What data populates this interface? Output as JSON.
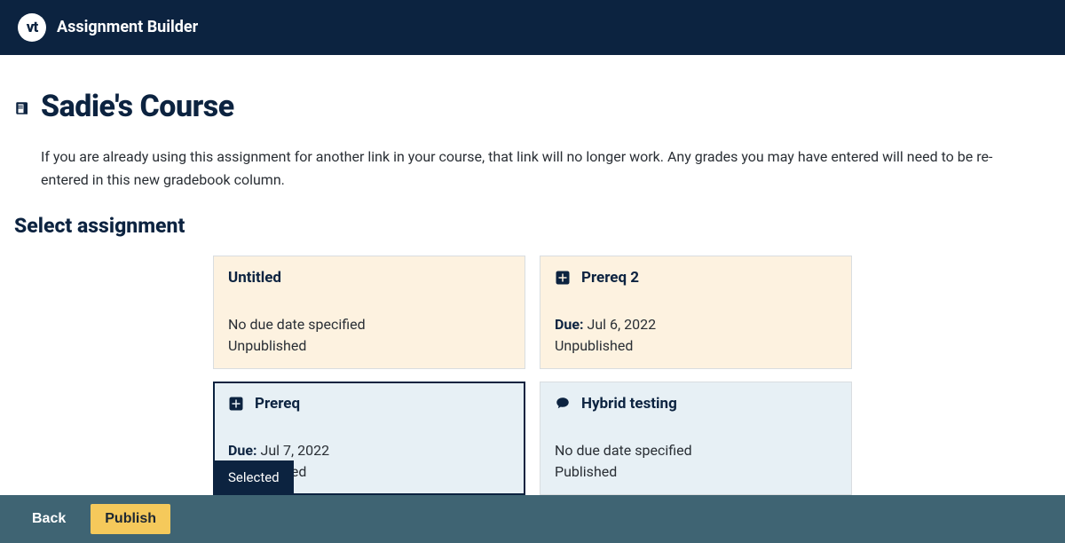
{
  "appbar": {
    "logo_text": "vt",
    "title": "Assignment Builder"
  },
  "course": {
    "title": "Sadie's Course",
    "info_text": "If you are already using this assignment for another link in your course, that link will no longer work. Any grades you may have entered will need to be re-entered in this new gradebook column."
  },
  "section": {
    "select_title": "Select assignment"
  },
  "assignments": [
    {
      "title": "Untitled",
      "icon": null,
      "due_label": null,
      "due_value": "No due date specified",
      "status": "Unpublished",
      "variant": "cream",
      "selected": false
    },
    {
      "title": "Prereq 2",
      "icon": "plus-box",
      "due_label": "Due:",
      "due_value": "Jul 6, 2022",
      "status": "Unpublished",
      "variant": "cream",
      "selected": false
    },
    {
      "title": "Prereq",
      "icon": "plus-box",
      "due_label": "Due:",
      "due_value": "Jul 7, 2022",
      "status": "Unpublished",
      "variant": "blue",
      "selected": true
    },
    {
      "title": "Hybrid testing",
      "icon": "chat",
      "due_label": null,
      "due_value": "No due date specified",
      "status": "Published",
      "variant": "blue",
      "selected": false
    }
  ],
  "selected_badge_label": "Selected",
  "footer": {
    "back_label": "Back",
    "publish_label": "Publish"
  }
}
